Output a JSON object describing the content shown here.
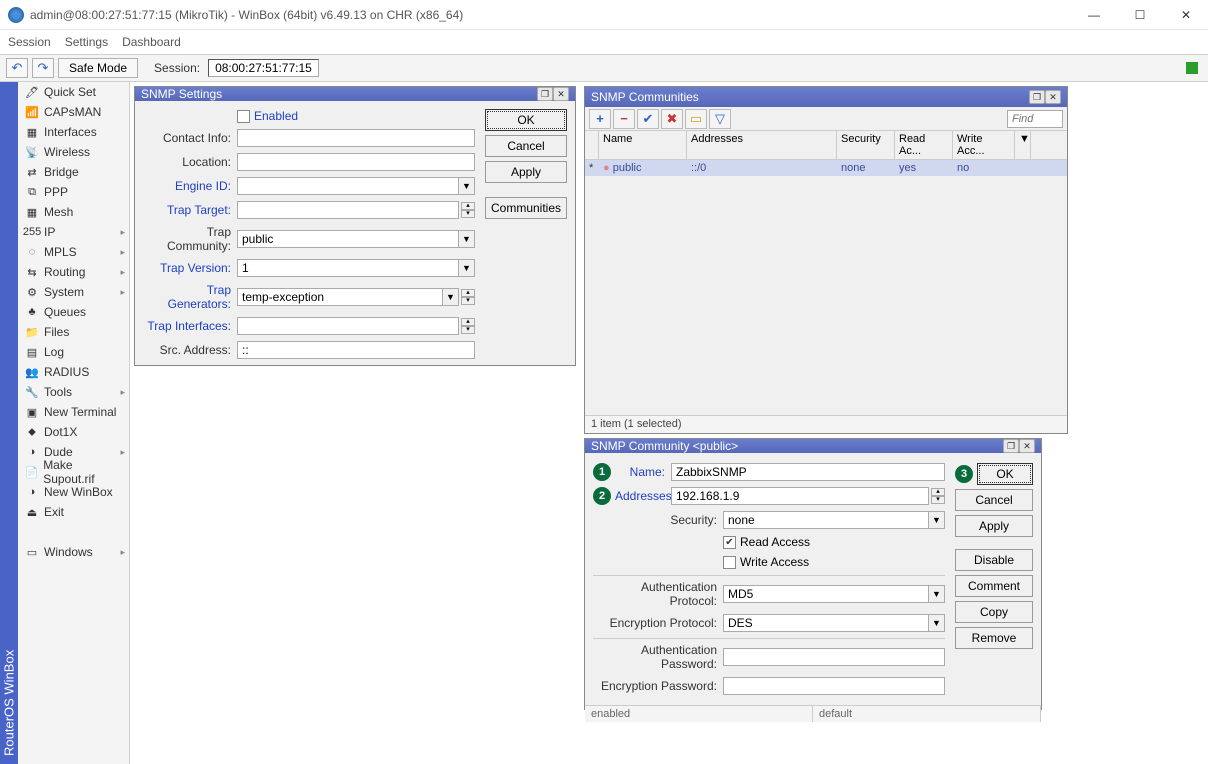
{
  "title": "admin@08:00:27:51:77:15 (MikroTik) - WinBox (64bit) v6.49.13 on CHR (x86_64)",
  "menubar": {
    "session": "Session",
    "settings": "Settings",
    "dashboard": "Dashboard"
  },
  "toolbar": {
    "safe_mode": "Safe Mode",
    "session_label": "Session:",
    "session_value": "08:00:27:51:77:15"
  },
  "sidebar": {
    "items": [
      {
        "label": "Quick Set"
      },
      {
        "label": "CAPsMAN"
      },
      {
        "label": "Interfaces"
      },
      {
        "label": "Wireless"
      },
      {
        "label": "Bridge"
      },
      {
        "label": "PPP"
      },
      {
        "label": "Mesh"
      },
      {
        "label": "IP",
        "sub": true
      },
      {
        "label": "MPLS",
        "sub": true
      },
      {
        "label": "Routing",
        "sub": true
      },
      {
        "label": "System",
        "sub": true
      },
      {
        "label": "Queues"
      },
      {
        "label": "Files"
      },
      {
        "label": "Log"
      },
      {
        "label": "RADIUS"
      },
      {
        "label": "Tools",
        "sub": true
      },
      {
        "label": "New Terminal"
      },
      {
        "label": "Dot1X"
      },
      {
        "label": "Dude",
        "sub": true
      },
      {
        "label": "Make Supout.rif"
      },
      {
        "label": "New WinBox"
      },
      {
        "label": "Exit"
      },
      {
        "label": "Windows",
        "sub": true,
        "gap": true
      }
    ]
  },
  "vtab": "RouterOS WinBox",
  "snmp_settings": {
    "title": "SNMP Settings",
    "enabled_label": "Enabled",
    "contact_label": "Contact Info:",
    "location_label": "Location:",
    "engine_label": "Engine ID:",
    "trap_target_label": "Trap Target:",
    "trap_community_label": "Trap Community:",
    "trap_community_value": "public",
    "trap_version_label": "Trap Version:",
    "trap_version_value": "1",
    "trap_gen_label": "Trap Generators:",
    "trap_gen_value": "temp-exception",
    "trap_if_label": "Trap Interfaces:",
    "src_label": "Src. Address:",
    "src_value": "::",
    "btn_ok": "OK",
    "btn_cancel": "Cancel",
    "btn_apply": "Apply",
    "btn_comm": "Communities"
  },
  "communities": {
    "title": "SNMP Communities",
    "find_placeholder": "Find",
    "cols": {
      "name": "Name",
      "addresses": "Addresses",
      "security": "Security",
      "readacc": "Read Ac...",
      "writeacc": "Write Acc..."
    },
    "row": {
      "star": "*",
      "name": "public",
      "addresses": "::/0",
      "security": "none",
      "readacc": "yes",
      "writeacc": "no"
    },
    "status": "1 item (1 selected)"
  },
  "community_edit": {
    "title": "SNMP Community <public>",
    "name_label": "Name:",
    "name_value": "ZabbixSNMP",
    "addr_label": "Addresses:",
    "addr_value": "192.168.1.9",
    "security_label": "Security:",
    "security_value": "none",
    "read_label": "Read Access",
    "write_label": "Write Access",
    "auth_proto_label": "Authentication Protocol:",
    "auth_proto_value": "MD5",
    "enc_proto_label": "Encryption Protocol:",
    "enc_proto_value": "DES",
    "auth_pass_label": "Authentication Password:",
    "enc_pass_label": "Encryption Password:",
    "btn_ok": "OK",
    "btn_cancel": "Cancel",
    "btn_apply": "Apply",
    "btn_disable": "Disable",
    "btn_comment": "Comment",
    "btn_copy": "Copy",
    "btn_remove": "Remove",
    "status_enabled": "enabled",
    "status_default": "default",
    "badge1": "1",
    "badge2": "2",
    "badge3": "3"
  }
}
